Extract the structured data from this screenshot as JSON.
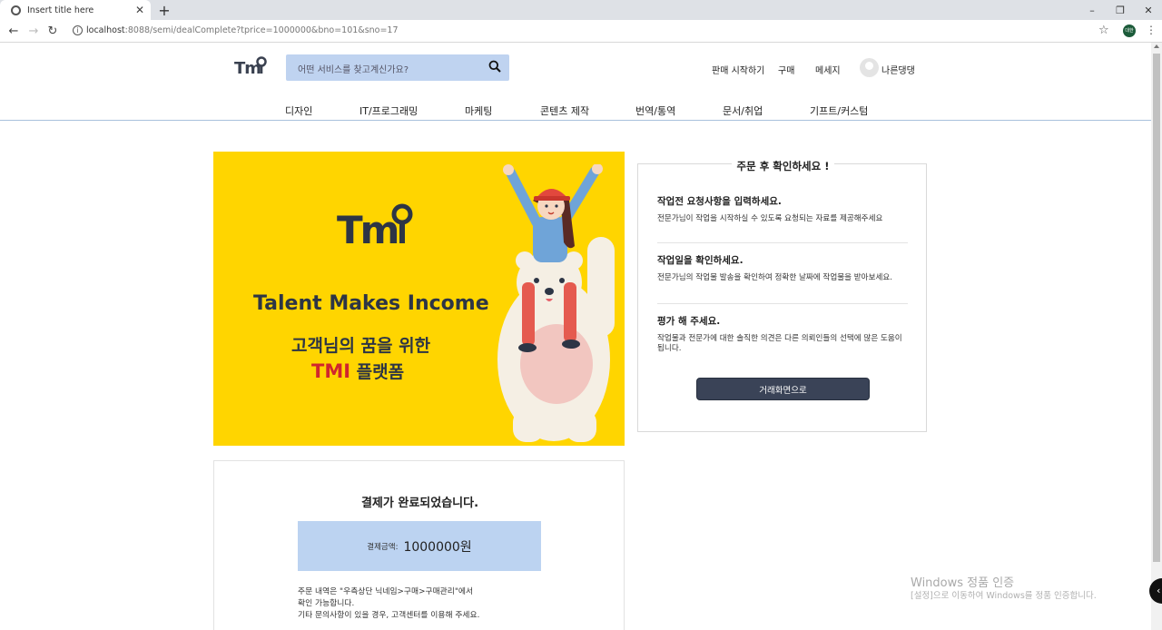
{
  "browser": {
    "tab_title": "Insert title here",
    "tab_close": "✕",
    "new_tab": "+",
    "url_host": "localhost",
    "url_rest": ":8088/semi/dealComplete?tprice=1000000&bno=101&sno=17",
    "profile_label": "대한",
    "window_minimize": "–",
    "window_restore": "❐",
    "window_close": "✕"
  },
  "header": {
    "logo": "TMI",
    "search_placeholder": "어떤 서비스를 찾고계신가요?",
    "nav": {
      "start_selling": "판매 시작하기",
      "purchase": "구매",
      "message": "메세지",
      "username": "나른댕댕"
    }
  },
  "categories": [
    "디자인",
    "IT/프로그래밍",
    "마케팅",
    "콘텐츠 제작",
    "번역/통역",
    "문서/취업",
    "기프트/커스텀"
  ],
  "banner": {
    "logo": "TMI",
    "slogan": "Talent Makes Income",
    "line1": "고객님의 꿈을 위한",
    "line2_red": "TMI",
    "line2_rest": " 플랫폼"
  },
  "checklist": {
    "title": "주문 후 확인하세요 !",
    "steps": [
      {
        "heading": "작업전 요청사항을 입력하세요.",
        "body": "전문가님이 작업을 시작하실 수 있도록 요청되는 자료를 제공해주세요"
      },
      {
        "heading": "작업일을 확인하세요.",
        "body": "전문가님의 작업물 발송을 확인하여 정확한 날짜에 작업물을 받아보세요."
      },
      {
        "heading": "평가 해 주세요.",
        "body": "작업물과 전문가에 대한 솔직한 의견은 다른 의뢰인들의 선택에 많은 도움이 됩니다."
      }
    ],
    "button": "거래화면으로"
  },
  "payment": {
    "title": "결제가 완료되었습니다.",
    "amount_label": "결제금액:",
    "amount_value": "1000000원",
    "note_line1": "주문 내역은 \"우측상단 닉네임>구매>구매관리\"에서",
    "note_line2": "확인 가능합니다.",
    "note_line3": "기타 문의사항이 있을 경우, 고객센터를 이용해 주세요."
  },
  "watermark": {
    "line1": "Windows 정품 인증",
    "line2": "[설정]으로 이동하여 Windows를 정품 인증합니다."
  },
  "colors": {
    "banner_yellow": "#ffd500",
    "search_bg": "#bfd3f0",
    "amount_bg": "#bcd3f1",
    "button_dark": "#3a4357",
    "tmi_red": "#d0262d"
  }
}
